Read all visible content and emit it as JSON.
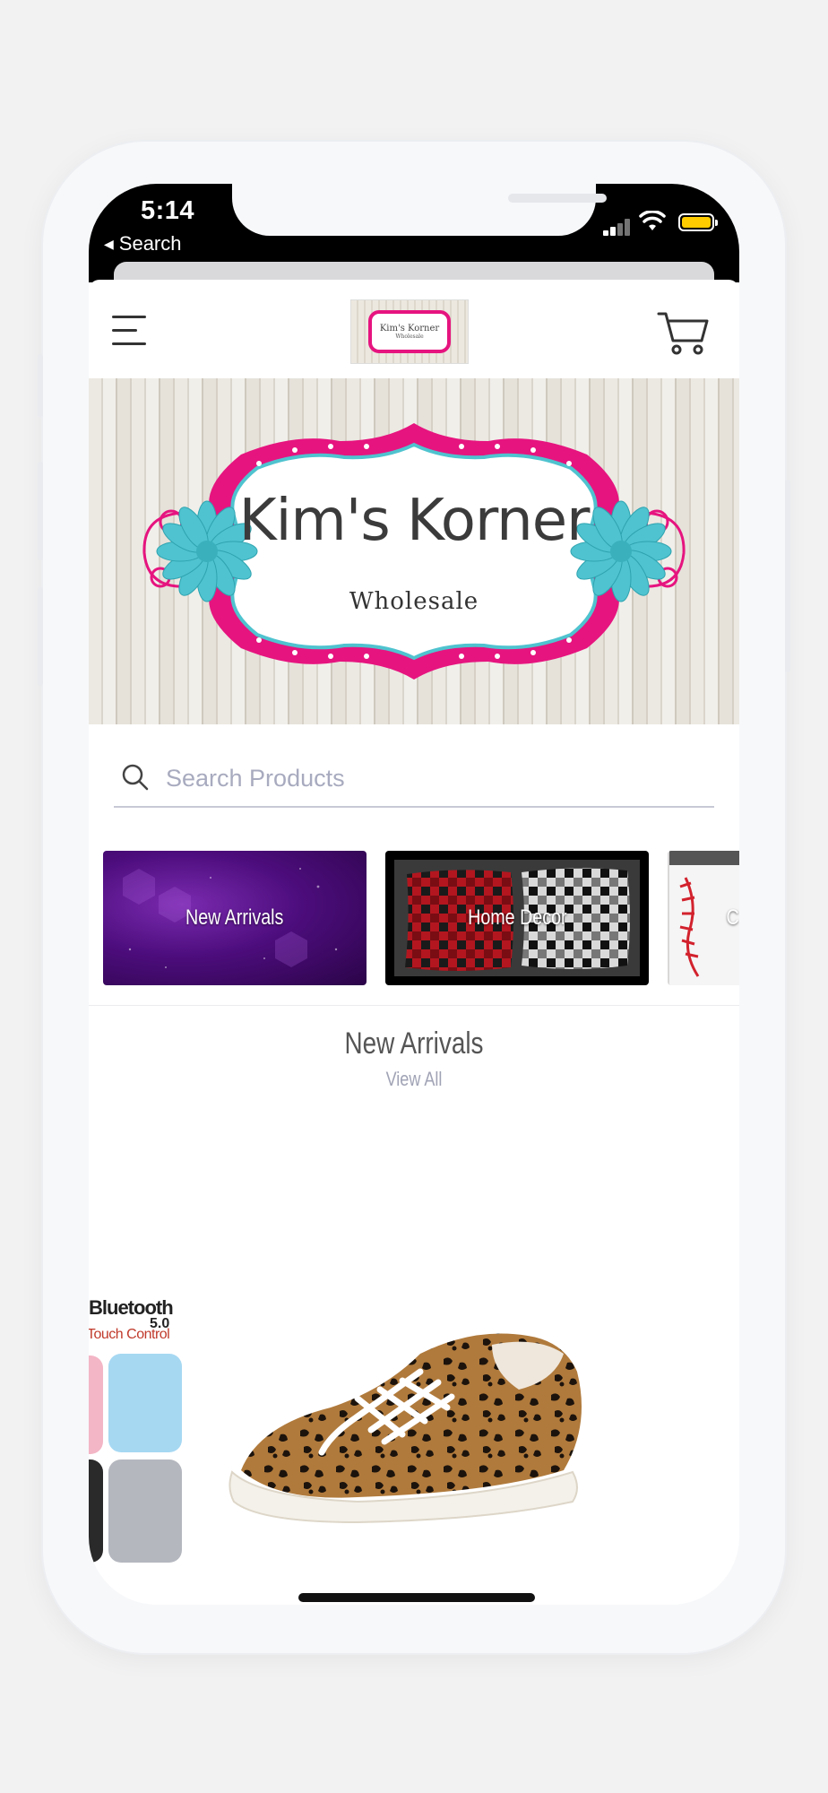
{
  "status_bar": {
    "time": "5:14",
    "back_label": "Search"
  },
  "header": {
    "logo_title": "Kim's Korner",
    "logo_subtitle": "Wholesale"
  },
  "banner": {
    "title": "Kim's Korner",
    "subtitle": "Wholesale"
  },
  "search": {
    "placeholder": "Search Products"
  },
  "categories": [
    {
      "label": "New Arrivals"
    },
    {
      "label": "Home Decor"
    },
    {
      "label": "C"
    }
  ],
  "section": {
    "title": "New Arrivals",
    "view_all": "View All"
  },
  "products": {
    "earbuds_text_1": "Bluetooth",
    "earbuds_text_2": "5.0",
    "earbuds_text_3": "Touch Control"
  },
  "colors": {
    "brand_pink": "#e6147f",
    "brand_teal": "#4fc3cf",
    "battery": "#ffcc00"
  }
}
